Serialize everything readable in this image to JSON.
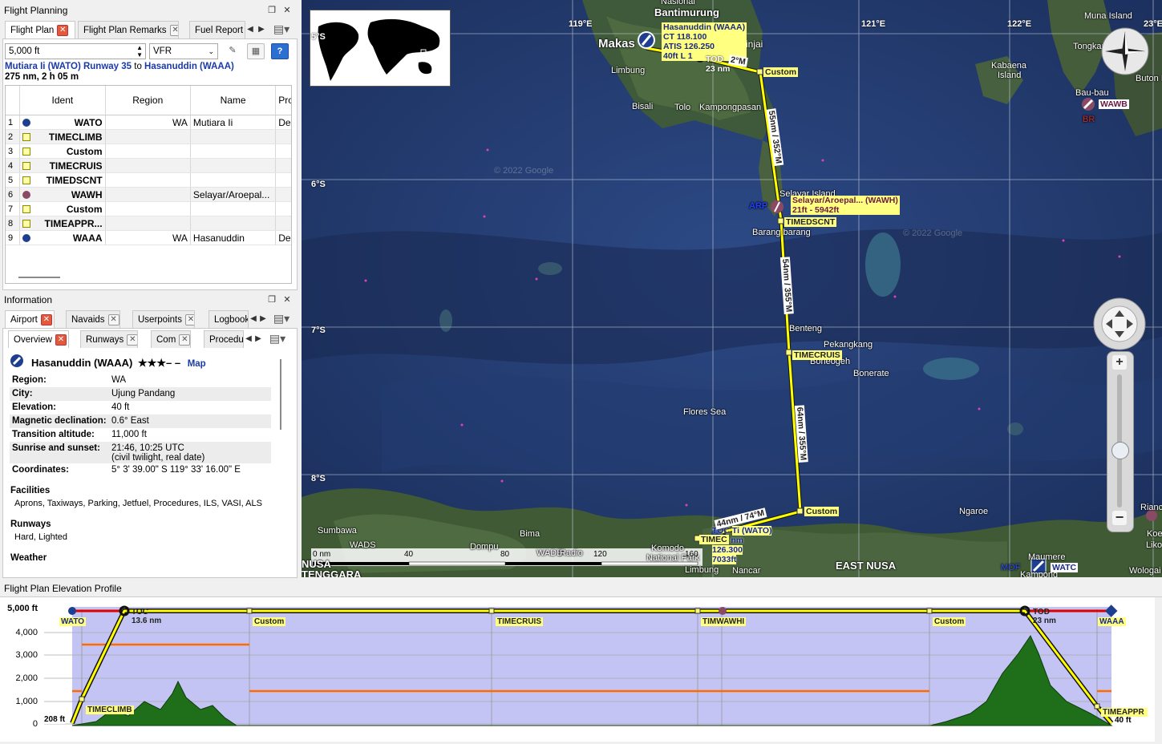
{
  "flight_planning": {
    "title": "Flight Planning",
    "tabs": [
      "Flight Plan",
      "Flight Plan Remarks",
      "Fuel Report"
    ],
    "altitude": "5,000 ft",
    "flight_rules": "VFR",
    "route_from": "Mutiara Ii (WATO) Runway 35",
    "route_to_word": "to",
    "route_to": "Hasanuddin (WAAA)",
    "distance_time": "275 nm, 2 h 05 m",
    "columns": [
      "Ident",
      "Region",
      "Name",
      "Pro"
    ],
    "rows": [
      {
        "num": "1",
        "ident": "WATO",
        "region": "WA",
        "name": "Mutiara Ii",
        "proc": "Departu",
        "icon": "airport-dark-icon"
      },
      {
        "num": "2",
        "ident": "TIMECLIMB",
        "region": "",
        "name": "",
        "proc": "",
        "icon": "waypoint-icon"
      },
      {
        "num": "3",
        "ident": "Custom",
        "region": "",
        "name": "",
        "proc": "",
        "icon": "waypoint-icon"
      },
      {
        "num": "4",
        "ident": "TIMECRUIS",
        "region": "",
        "name": "",
        "proc": "",
        "icon": "waypoint-icon"
      },
      {
        "num": "5",
        "ident": "TIMEDSCNT",
        "region": "",
        "name": "",
        "proc": "",
        "icon": "waypoint-icon"
      },
      {
        "num": "6",
        "ident": "WAWH",
        "region": "",
        "name": "Selayar/Aroepal...",
        "proc": "",
        "icon": "airport-closed-icon"
      },
      {
        "num": "7",
        "ident": "Custom",
        "region": "",
        "name": "",
        "proc": "",
        "icon": "waypoint-icon"
      },
      {
        "num": "8",
        "ident": "TIMEAPPR...",
        "region": "",
        "name": "",
        "proc": "",
        "icon": "waypoint-icon"
      },
      {
        "num": "9",
        "ident": "WAAA",
        "region": "WA",
        "name": "Hasanuddin",
        "proc": "Destina",
        "icon": "airport-runway-icon"
      }
    ]
  },
  "information": {
    "title": "Information",
    "tabs": [
      "Airport",
      "Navaids",
      "Userpoints",
      "Logbook"
    ],
    "subtabs": [
      "Overview",
      "Runways",
      "Com",
      "Procedu"
    ],
    "airport_title": "Hasanuddin (WAAA)",
    "stars": "★★★– –",
    "map_link": "Map",
    "rows": [
      {
        "key": "Region:",
        "val": "WA"
      },
      {
        "key": "City:",
        "val": "Ujung Pandang"
      },
      {
        "key": "Elevation:",
        "val": "40 ft"
      },
      {
        "key": "Magnetic declination:",
        "val": "0.6° East"
      },
      {
        "key": "Transition altitude:",
        "val": "11,000 ft"
      },
      {
        "key": "Sunrise and sunset:",
        "val": "21:46, 10:25 UTC",
        "val2": "(civil twilight, real date)"
      },
      {
        "key": "Coordinates:",
        "val": "5° 3' 39.00\" S 119° 33' 16.00\" E"
      }
    ],
    "facilities_head": "Facilities",
    "facilities": "Aprons, Taxiways, Parking, Jetfuel, Procedures, ILS, VASI, ALS",
    "runways_head": "Runways",
    "runways": "Hard, Lighted",
    "weather_head": "Weather"
  },
  "map": {
    "longitudes": [
      "119°E",
      "121°E",
      "122°E",
      "23°E"
    ],
    "latitudes": [
      "5°S",
      "6°S",
      "7°S",
      "8°S"
    ],
    "places": [
      "Nasional",
      "Bantimurung",
      "Makas",
      "Sinjai",
      "Limbung",
      "Bisali",
      "Tolo",
      "Kampongpasan",
      "Muna Island",
      "Tongkan",
      "Kabaena",
      "Island",
      "Buton Is",
      "Bau-bau",
      "Selayar Island",
      "Barang barang",
      "Benteng",
      "Pekangkang",
      "Boneogeh",
      "Bonerate",
      "Flores Sea",
      "Sumbawa",
      "Bima",
      "Dompu",
      "Komodo",
      "National Park",
      "Ngaroe",
      "Rianc",
      "Koek",
      "Liko",
      "Maumere",
      "Wologai",
      "EAST NUSA",
      "TENGGARA",
      "NUSA",
      "Kampong",
      "Nancar",
      "Limbung",
      "ARP"
    ],
    "airport_info": {
      "title": "Hasanuddin (WAAA)",
      "ct": "CT 118.100",
      "atis": "ATIS 126.250",
      "elev": "40ft L 1"
    },
    "dest_info": {
      "title": "Ti (WATO)",
      "freq": "126.300",
      "elev": "7033ft"
    },
    "wawh_label": "Selayar/Aroepal... (WAWH)",
    "wawh_elev": "21ft - 5942ft",
    "waypoint_labels": [
      "Custom",
      "TIMEDSCNT",
      "TIMECRUIS",
      "Custom",
      "TIMEC"
    ],
    "tod_label": "TOD",
    "tod_dist": "23 nm",
    "toc_label": "TOC",
    "toc_dist": "13.6 nm",
    "leg_labels": [
      "55nm / 352°M",
      "54nm / 355°M",
      "64nm / 355°M",
      "44nm / 74°M",
      "2°M"
    ],
    "airport_badges": [
      "WAWB",
      "WADB",
      "WATC",
      "WADS",
      "MOF",
      "BR",
      "Radio"
    ],
    "scale": {
      "ticks": [
        "0 nm",
        "40",
        "80",
        "120",
        "160"
      ]
    },
    "watermark": "© 2022 Google"
  },
  "profile": {
    "title": "Flight Plan Elevation Profile",
    "y_ticks": [
      "5,000 ft",
      "4,000",
      "3,000",
      "2,000",
      "1,000",
      "0"
    ],
    "start_elev": "208 ft",
    "end_elev": "40 ft",
    "labels": [
      "WATO",
      "TIMECLIMB",
      "TOC",
      "13.6 nm",
      "Custom",
      "TIMECRUIS",
      "TIMWAWHI",
      "Custom",
      "TOD",
      "23 nm",
      "WAAA",
      "TIMEAPPR"
    ]
  },
  "colors": {
    "route": "#ffff00",
    "profile_bg": "#c4c4f4",
    "terrain": "#1f6e1a",
    "safe_alt": "#ff6a00",
    "climb_red": "#e00000"
  }
}
